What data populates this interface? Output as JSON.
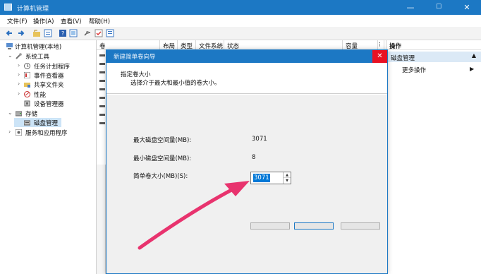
{
  "window": {
    "title": "计算机管理",
    "minimize": "—",
    "maximize": "☐",
    "close": "✕"
  },
  "menu": [
    "文件(F)",
    "操作(A)",
    "查看(V)",
    "帮助(H)"
  ],
  "toolbar_icons": [
    "back-icon",
    "forward-icon",
    "up-folder-icon",
    "properties-icon",
    "help-icon",
    "view-icon",
    "connect-icon",
    "check-icon",
    "list-icon"
  ],
  "tree": {
    "root": "计算机管理(本地)",
    "system_tools": "系统工具",
    "task_scheduler": "任务计划程序",
    "event_viewer": "事件查看器",
    "shared_folders": "共享文件夹",
    "performance": "性能",
    "device_manager": "设备管理器",
    "storage": "存储",
    "disk_management": "磁盘管理",
    "services_apps": "服务和应用程序"
  },
  "columns": [
    "卷",
    "布局",
    "类型",
    "文件系统",
    "状态",
    "容量",
    "操作"
  ],
  "actions": {
    "header": "操作",
    "section": "磁盘管理",
    "more": "更多操作"
  },
  "dialog": {
    "title": "新建简单卷向导",
    "close": "✕",
    "heading": "指定卷大小",
    "subheading": "选择介于最大和最小值的卷大小。",
    "max_label": "最大磁盘空间量(MB):",
    "max_value": "3071",
    "min_label": "最小磁盘空间量(MB):",
    "min_value": "8",
    "size_label": "简单卷大小(MB)(S):",
    "size_value": "3071"
  },
  "colors": {
    "accent": "#1c78c4",
    "arrow": "#e8336e",
    "selection": "#0078d7",
    "close_red": "#e81123"
  }
}
